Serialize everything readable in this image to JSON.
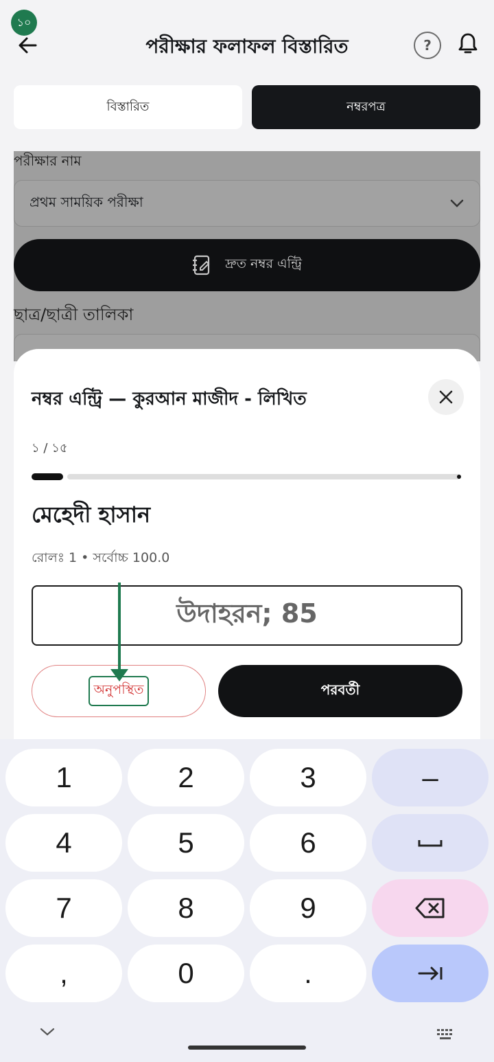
{
  "header": {
    "badge": "১০",
    "title": "পরীক্ষার ফলাফল বিস্তারিত",
    "help": "?"
  },
  "tabs": [
    {
      "label": "বিস্তারিত",
      "active": false
    },
    {
      "label": "নম্বরপত্র",
      "active": true
    }
  ],
  "background": {
    "exam_label": "পরীক্ষার নাম",
    "exam_selected": "প্রথম সাময়িক পরীক্ষা",
    "quick_entry": "দ্রুত নম্বর এন্ট্রি",
    "student_list_label": "ছাত্র/ছাত্রী তালিকা"
  },
  "sheet": {
    "title": "নম্বর এন্ট্রি — কুরআন মাজীদ - লিখিত",
    "counter": "১ / ১৫",
    "progress_fraction": 0.0667,
    "student_name": "মেহেদী হাসান",
    "meta": "রোলঃ 1  •  সর্বোচ্চ 100.0",
    "input_placeholder": "উদাহরন; 85",
    "absent_label": "অনুপস্থিত",
    "next_label": "পরবর্তী"
  },
  "keyboard": {
    "rows": [
      [
        "1",
        "2",
        "3",
        "–"
      ],
      [
        "4",
        "5",
        "6",
        "␣"
      ],
      [
        "7",
        "8",
        "9",
        "⌫"
      ],
      [
        ",",
        "0",
        ".",
        "→|"
      ]
    ]
  },
  "colors": {
    "accent_dark": "#15171a",
    "absent_red": "#d33838",
    "annotation_green": "#1f7a4f"
  }
}
